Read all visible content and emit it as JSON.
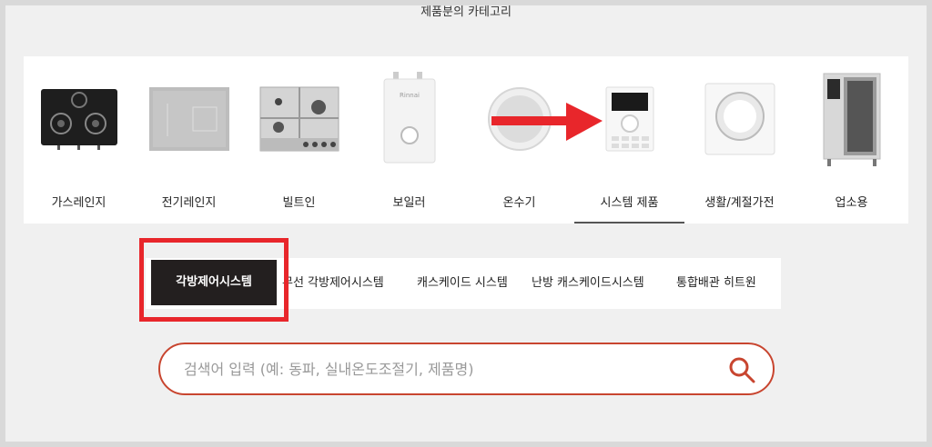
{
  "section_title": "제품분의 카테고리",
  "categories": [
    {
      "label": "가스레인지",
      "icon": "gas-range-icon"
    },
    {
      "label": "전기레인지",
      "icon": "electric-range-icon"
    },
    {
      "label": "빌트인",
      "icon": "builtin-cooktop-icon"
    },
    {
      "label": "보일러",
      "icon": "boiler-icon"
    },
    {
      "label": "온수기",
      "icon": "water-heater-icon"
    },
    {
      "label": "시스템 제품",
      "icon": "thermostat-icon"
    },
    {
      "label": "생활/계절가전",
      "icon": "dryer-icon"
    },
    {
      "label": "업소용",
      "icon": "commercial-oven-icon"
    }
  ],
  "selected_category": "시스템 제품",
  "subtabs": [
    {
      "label": "각방제어시스템"
    },
    {
      "label": "무선 각방제어시스템"
    },
    {
      "label": "캐스케이드 시스템"
    },
    {
      "label": "난방 캐스케이드시스템"
    },
    {
      "label": "통합배관 히트원"
    }
  ],
  "selected_subtab": "각방제어시스템",
  "search": {
    "placeholder": "검색어 입력 (예: 동파, 실내온도조절기, 제품명)",
    "value": ""
  },
  "colors": {
    "highlight": "#e8262b",
    "search_border": "#c8452f",
    "active_tab": "#231f1f"
  }
}
